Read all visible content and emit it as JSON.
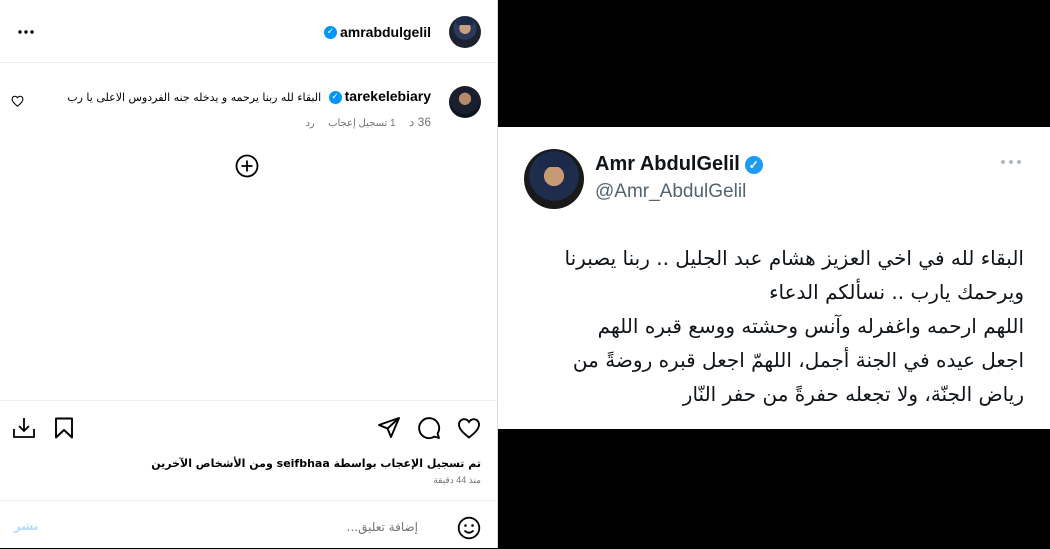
{
  "post": {
    "header": {
      "username": "amrabdulgelil",
      "more_icon": "more-horizontal-icon"
    },
    "comment": {
      "username": "tarekelebiary",
      "text": "البقاء لله ربنا يرحمه و يدخله جنه الفردوس الاعلى يا رب",
      "time": "36 د",
      "likes": "1 تسجيل إعجاب",
      "reply": "رد",
      "like_icon": "heart-outline-icon"
    },
    "load_more_icon": "plus-circle-icon",
    "actions": {
      "like_icon": "heart-outline-icon",
      "comment_icon": "comment-bubble-icon",
      "share_icon": "paper-plane-icon",
      "save_icon": "bookmark-icon",
      "download_icon": "download-icon"
    },
    "likes_summary": "تم تسجيل الإعجاب بواسطة seifbhaa ومن الأشخاص الآخرين",
    "posted_ago": "منذ 44 دقيقة",
    "comment_input": {
      "placeholder": "إضافة تعليق...",
      "post_label": "نشر",
      "emoji_icon": "smiley-icon"
    }
  },
  "tweet": {
    "name": "Amr AbdulGelil",
    "handle": "@Amr_AbdulGelil",
    "more_icon": "more-horizontal-icon",
    "text": "البقاء لله في اخي العزيز هشام عبد الجليل .. ربنا يصبرنا\nويرحمك يارب .. نسألكم الدعاء\nاللهم ارحمه واغفرله وآنس وحشته ووسع قبره اللهم\nاجعل عيده في الجنة أجمل، اللهمّ اجعل قبره روضةً من\nرياض الجنّة، ولا تجعله حفرةً من حفر النّار"
  },
  "colors": {
    "verified_instagram": "#0095f6",
    "verified_twitter": "#1d9bf0",
    "post_link_disabled": "#b3dbff",
    "background_right": "#000000"
  }
}
